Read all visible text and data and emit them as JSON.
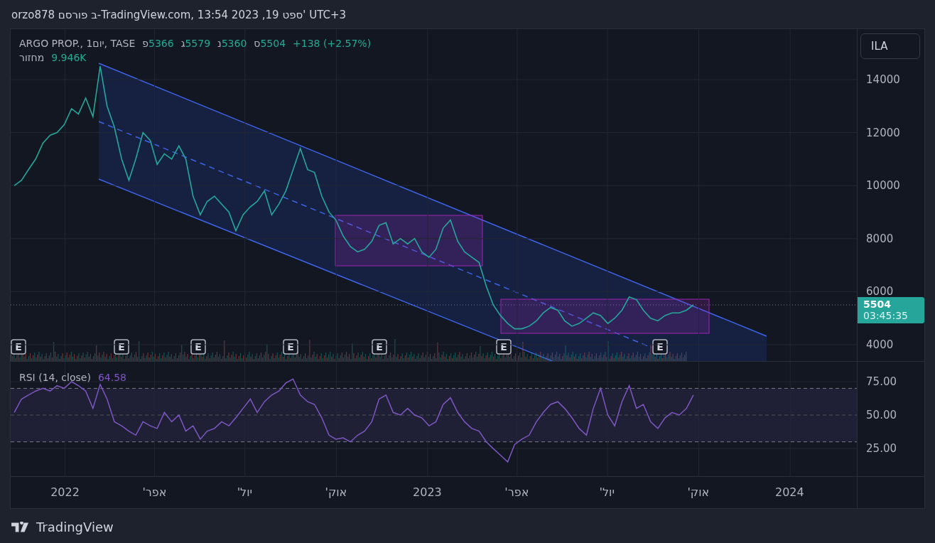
{
  "caption": "orzo878 ב פורסם-TradingView.com, 13:54 2023 ,19 ספט' UTC+3",
  "legend": {
    "symbol": "ARGO PROP., 1יום, TASE",
    "open": {
      "letter": "פ",
      "value": "5366"
    },
    "high": {
      "letter": "ג",
      "value": "5579"
    },
    "low": {
      "letter": "נ",
      "value": "5360"
    },
    "close": {
      "letter": "ס",
      "value": "5504"
    },
    "change": "+138 (+2.57%)",
    "volume_label": "מחזור",
    "volume_value": "9.946K"
  },
  "currency_button": "ILA",
  "last_price": {
    "value": "5504",
    "countdown": "03:45:35"
  },
  "price_pane": {
    "chart_data": {
      "type": "line",
      "grid": true,
      "ylim": [
        3383,
        15900
      ],
      "yticks": [
        {
          "value": 14000,
          "label": "14000"
        },
        {
          "value": 12000,
          "label": "12000"
        },
        {
          "value": 10000,
          "label": "10000"
        },
        {
          "value": 8000,
          "label": "8000"
        },
        {
          "value": 6000,
          "label": "6000"
        },
        {
          "value": 4000,
          "label": "4000"
        }
      ],
      "series": [
        {
          "color": "#26a69a",
          "values": [
            10000,
            10200,
            10600,
            11000,
            11600,
            11900,
            12000,
            12300,
            12900,
            12700,
            13300,
            12600,
            14500,
            13000,
            12200,
            11000,
            10200,
            11000,
            12000,
            11700,
            10800,
            11200,
            11000,
            11500,
            11000,
            9600,
            8900,
            9400,
            9600,
            9300,
            9000,
            8300,
            8900,
            9200,
            9400,
            9800,
            8900,
            9300,
            9800,
            10600,
            11400,
            10600,
            10500,
            9600,
            9000,
            8700,
            8100,
            7700,
            7500,
            7600,
            7900,
            8500,
            8600,
            7800,
            8000,
            7800,
            8000,
            7500,
            7300,
            7600,
            8400,
            8700,
            7900,
            7500,
            7300,
            7100,
            6200,
            5500,
            5100,
            4800,
            4600,
            4600,
            4700,
            4900,
            5200,
            5400,
            5300,
            4900,
            4700,
            4800,
            5000,
            5200,
            5100,
            4800,
            5000,
            5300,
            5800,
            5700,
            5300,
            5000,
            4900,
            5100,
            5200,
            5200,
            5300,
            5500
          ]
        }
      ]
    },
    "earnings_markers": [
      {
        "text": "E"
      },
      {
        "text": "E"
      },
      {
        "text": "E"
      },
      {
        "text": "E"
      },
      {
        "text": "E"
      },
      {
        "text": "E"
      },
      {
        "text": "E"
      }
    ]
  },
  "rsi_pane": {
    "name": "RSI (14, close)",
    "value": "64.58",
    "chart_data": {
      "type": "line",
      "grid": true,
      "xlim": [
        2021.85,
        2024.37
      ],
      "ylim": [
        4.3,
        89.9
      ],
      "x": [
        2021.86,
        2021.88,
        2021.899,
        2021.919,
        2021.939,
        2021.959,
        2021.978,
        2021.998,
        2022.018,
        2022.037,
        2022.057,
        2022.077,
        2022.097,
        2022.116,
        2022.136,
        2022.156,
        2022.176,
        2022.195,
        2022.215,
        2022.235,
        2022.254,
        2022.274,
        2022.294,
        2022.314,
        2022.333,
        2022.353,
        2022.373,
        2022.392,
        2022.412,
        2022.432,
        2022.452,
        2022.471,
        2022.491,
        2022.511,
        2022.53,
        2022.55,
        2022.57,
        2022.59,
        2022.609,
        2022.629,
        2022.649,
        2022.669,
        2022.688,
        2022.708,
        2022.728,
        2022.747,
        2022.767,
        2022.787,
        2022.807,
        2022.826,
        2022.846,
        2022.866,
        2022.885,
        2022.905,
        2022.925,
        2022.945,
        2022.964,
        2022.984,
        2023.004,
        2023.023,
        2023.043,
        2023.063,
        2023.083,
        2023.102,
        2023.122,
        2023.142,
        2023.162,
        2023.181,
        2023.201,
        2023.221,
        2023.24,
        2023.26,
        2023.28,
        2023.3,
        2023.319,
        2023.339,
        2023.359,
        2023.378,
        2023.398,
        2023.418,
        2023.438,
        2023.457,
        2023.477,
        2023.497,
        2023.516,
        2023.536,
        2023.556,
        2023.576,
        2023.595,
        2023.615,
        2023.635,
        2023.655,
        2023.674,
        2023.694,
        2023.714,
        2023.733
      ],
      "yticks": [
        {
          "value": 75,
          "label": "75.00"
        },
        {
          "value": 50,
          "label": "50.00"
        },
        {
          "value": 25,
          "label": "25.00"
        }
      ],
      "xticks": [
        {
          "value": 2022,
          "label": "2022"
        },
        {
          "value": 2022.247,
          "label": "אפר'"
        },
        {
          "value": 2022.496,
          "label": "יול'"
        },
        {
          "value": 2022.748,
          "label": "אוק'"
        },
        {
          "value": 2023,
          "label": "2023"
        },
        {
          "value": 2023.247,
          "label": "אפר'"
        },
        {
          "value": 2023.496,
          "label": "יול'"
        },
        {
          "value": 2023.748,
          "label": "אוק'"
        },
        {
          "value": 2024,
          "label": "2024"
        }
      ],
      "series": [
        {
          "color": "#7e57c2",
          "values": [
            52,
            62,
            65,
            68,
            70,
            68,
            72,
            70,
            75,
            72,
            68,
            55,
            73,
            62,
            45,
            42,
            38,
            35,
            45,
            42,
            40,
            52,
            45,
            50,
            38,
            42,
            32,
            38,
            40,
            45,
            42,
            48,
            55,
            62,
            52,
            60,
            65,
            68,
            74,
            77,
            65,
            60,
            58,
            48,
            35,
            32,
            33,
            30,
            35,
            38,
            45,
            62,
            65,
            52,
            50,
            55,
            50,
            48,
            42,
            45,
            58,
            63,
            52,
            45,
            40,
            38,
            30,
            25,
            20,
            15,
            28,
            32,
            35,
            45,
            52,
            58,
            60,
            55,
            48,
            40,
            35,
            55,
            70,
            50,
            42,
            60,
            72,
            55,
            58,
            45,
            40,
            48,
            52,
            50,
            55,
            65
          ]
        }
      ]
    }
  },
  "brand": "TradingView"
}
